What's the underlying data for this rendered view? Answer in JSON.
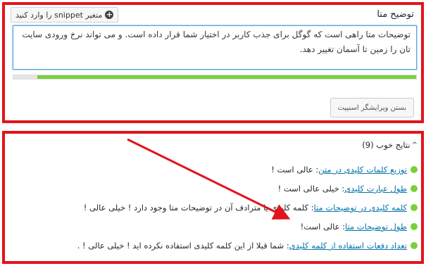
{
  "meta_description": {
    "title": "توضیح متا",
    "snippet_button_label": "متغیر snippet را وارد کنید",
    "text": "توضیحات متا راهی است که گوگل برای جذب کاربر در اختیار شما قرار داده است. و می تواند نرخ ورودی سایت تان را زمین تا آسمان تغییر دهد.",
    "progress_fraction": 0.94,
    "close_editor_label": "بستن ویرایشگر اسنیپت"
  },
  "results": {
    "header": "نتایج خوب (9)",
    "items": [
      {
        "link": "توزیع کلمات کلیدی در متن",
        "text": ": عالی است !"
      },
      {
        "link": "طول عبارت کلیدی",
        "text": ": خیلی عالی است !"
      },
      {
        "link": "کلمه کلیدی در توضیحات متا",
        "text": ": کلمه کلیدی یا مترادف آن در توضیحات متا وجود دارد ! خیلی عالی !"
      },
      {
        "link": "طول توضیحات متا ",
        "text": ": عالی است!"
      },
      {
        "link": "تعداد دفعات استفاده از کلمه کلیدی",
        "text": ": شما قبلا از این کلمه کلیدی استفاده نکرده اید ! خیلی عالی ! ."
      }
    ]
  },
  "colors": {
    "highlight_border": "#e3131b",
    "good_bullet": "#7ad03a",
    "link": "#0073aa",
    "arrow": "#e3131b"
  }
}
